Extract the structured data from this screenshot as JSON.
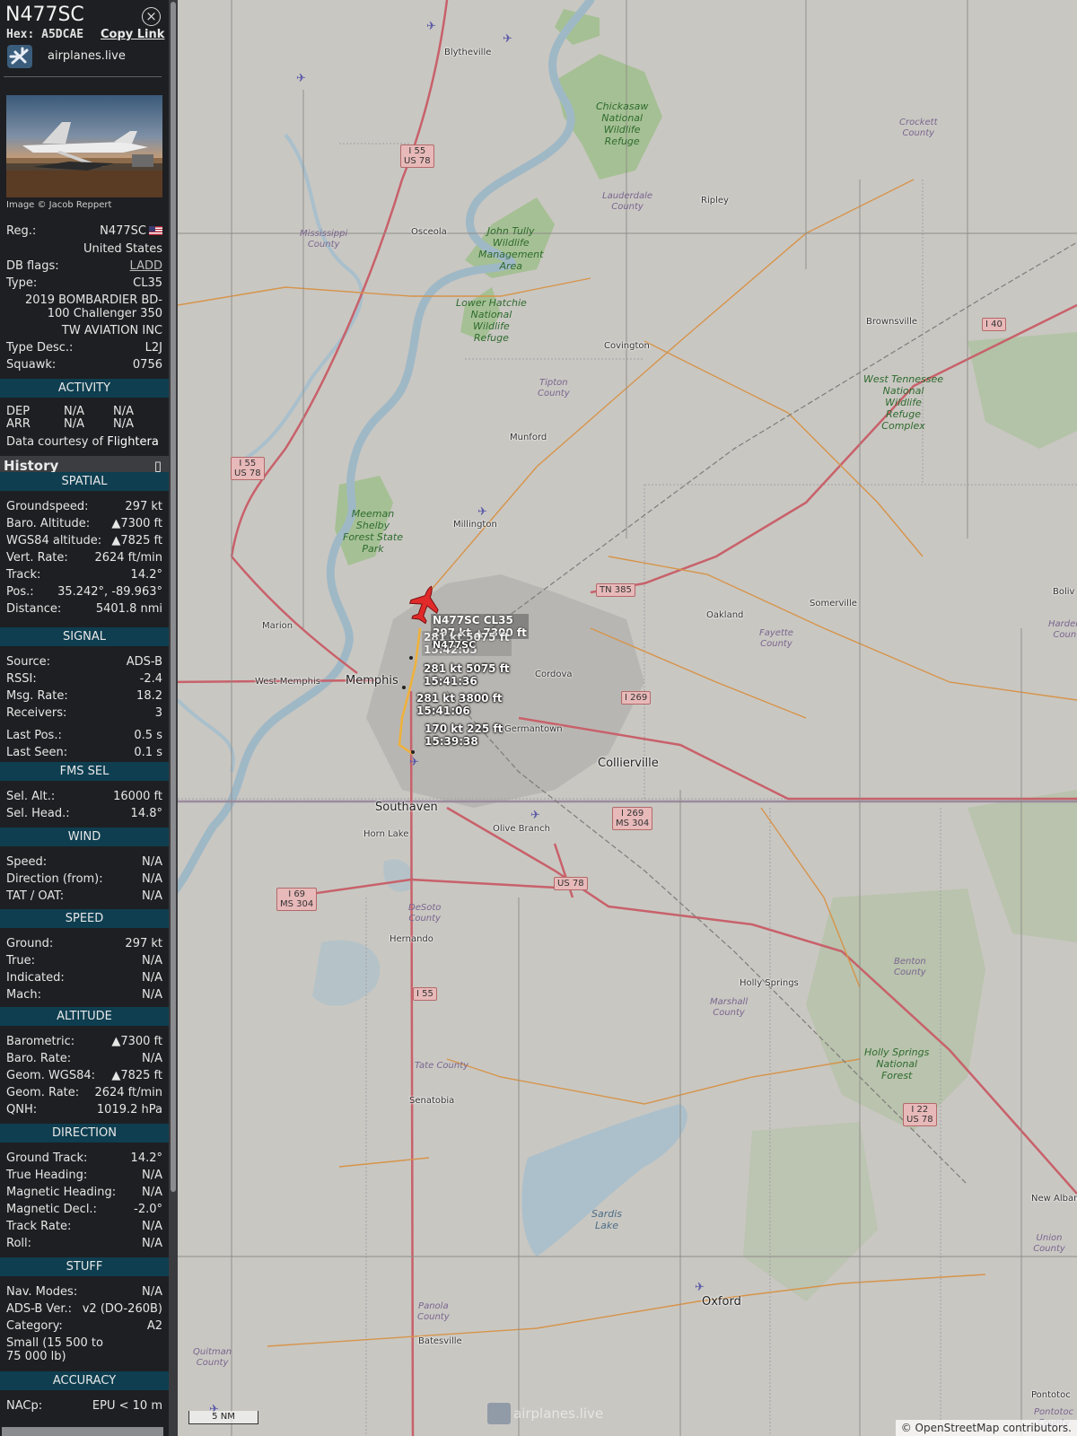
{
  "aircraft": {
    "callsign": "N477SC",
    "hex_label": "Hex:",
    "hex": "A5DCAE",
    "copy_link": "Copy Link",
    "provider": "airplanes.live",
    "photo_credit": "Image © Jacob Reppert",
    "reg_label": "Reg.:",
    "reg": "N477SC",
    "country": "United States",
    "db_flags_label": "DB flags:",
    "db_flags": "LADD",
    "type_label": "Type:",
    "type": "CL35",
    "type_full": "2019 BOMBARDIER BD-100 Challenger 350",
    "owner": "TW AVIATION INC",
    "type_desc_label": "Type Desc.:",
    "type_desc": "L2J",
    "squawk_label": "Squawk:",
    "squawk": "0756"
  },
  "activity": {
    "header": "ACTIVITY",
    "dep_label": "DEP",
    "dep_a": "N/A",
    "dep_b": "N/A",
    "arr_label": "ARR",
    "arr_a": "N/A",
    "arr_b": "N/A",
    "courtesy": "Data courtesy of",
    "courtesy_source": "Flightera"
  },
  "history": {
    "label": "History",
    "icon": "chevron-icon"
  },
  "spatial": {
    "header": "SPATIAL",
    "rows": [
      {
        "label": "Groundspeed:",
        "value": "297 kt"
      },
      {
        "label": "Baro. Altitude:",
        "value": "▲7300 ft"
      },
      {
        "label": "WGS84 altitude:",
        "value": "▲7825 ft"
      },
      {
        "label": "Vert. Rate:",
        "value": "2624 ft/min"
      },
      {
        "label": "Track:",
        "value": "14.2°"
      },
      {
        "label": "Pos.:",
        "value": "35.242°, -89.963°"
      },
      {
        "label": "Distance:",
        "value": "5401.8 nmi"
      }
    ]
  },
  "signal": {
    "header": "SIGNAL",
    "rows": [
      {
        "label": "Source:",
        "value": "ADS-B"
      },
      {
        "label": "RSSI:",
        "value": "-2.4"
      },
      {
        "label": "Msg. Rate:",
        "value": "18.2"
      },
      {
        "label": "Receivers:",
        "value": "3"
      },
      {
        "label": "Last Pos.:",
        "value": "0.5 s"
      },
      {
        "label": "Last Seen:",
        "value": "0.1 s"
      }
    ]
  },
  "fms": {
    "header": "FMS SEL",
    "rows": [
      {
        "label": "Sel. Alt.:",
        "value": "16000 ft"
      },
      {
        "label": "Sel. Head.:",
        "value": "14.8°"
      }
    ]
  },
  "wind": {
    "header": "WIND",
    "rows": [
      {
        "label": "Speed:",
        "value": "N/A"
      },
      {
        "label": "Direction (from):",
        "value": "N/A"
      },
      {
        "label": "TAT / OAT:",
        "value": "N/A"
      }
    ]
  },
  "speed": {
    "header": "SPEED",
    "rows": [
      {
        "label": "Ground:",
        "value": "297 kt"
      },
      {
        "label": "True:",
        "value": "N/A"
      },
      {
        "label": "Indicated:",
        "value": "N/A"
      },
      {
        "label": "Mach:",
        "value": "N/A"
      }
    ]
  },
  "altitude": {
    "header": "ALTITUDE",
    "rows": [
      {
        "label": "Barometric:",
        "value": "▲7300 ft"
      },
      {
        "label": "Baro. Rate:",
        "value": "N/A"
      },
      {
        "label": "Geom. WGS84:",
        "value": "▲7825 ft"
      },
      {
        "label": "Geom. Rate:",
        "value": "2624 ft/min"
      },
      {
        "label": "QNH:",
        "value": "1019.2 hPa"
      }
    ]
  },
  "direction": {
    "header": "DIRECTION",
    "rows": [
      {
        "label": "Ground Track:",
        "value": "14.2°"
      },
      {
        "label": "True Heading:",
        "value": "N/A"
      },
      {
        "label": "Magnetic Heading:",
        "value": "N/A"
      },
      {
        "label": "Magnetic Decl.:",
        "value": "-2.0°"
      },
      {
        "label": "Track Rate:",
        "value": "N/A"
      },
      {
        "label": "Roll:",
        "value": "N/A"
      }
    ]
  },
  "stuff": {
    "header": "STUFF",
    "rows": [
      {
        "label": "Nav. Modes:",
        "value": "N/A"
      },
      {
        "label": "ADS-B Ver.:",
        "value": "v2 (DO-260B)"
      },
      {
        "label": "Category:",
        "value": "A2"
      }
    ],
    "category_desc": "Small (15 500 to 75 000 lb)"
  },
  "accuracy": {
    "header": "ACCURACY",
    "rows": [
      {
        "label": "NACp:",
        "value": "EPU < 10 m"
      }
    ]
  },
  "map": {
    "aircraft_label": "N477SC CL35\n297 kt ▲7300 ft",
    "aircraft_label_ghost": "281 kt  5075 ft\n15:42:05",
    "aircraft_label_reg": "N477SC",
    "track_points": [
      {
        "label": "281 kt  5075 ft\n15:41:36"
      },
      {
        "label": "281 kt  3800 ft\n15:41:06"
      },
      {
        "label": "170 kt  225 ft\n15:39:38"
      }
    ],
    "cities": [
      "Memphis",
      "Collierville",
      "Southaven",
      "Oxford"
    ],
    "towns": [
      "Blytheville",
      "Osceola",
      "Ripley",
      "Brownsville",
      "Covington",
      "Munford",
      "Millington",
      "Marion",
      "West Memphis",
      "Oakland",
      "Cordova",
      "Germantown",
      "Somerville",
      "Olive Branch",
      "Horn Lake",
      "Hernando",
      "Holly Springs",
      "Senatobia",
      "Batesville",
      "New Albany",
      "Pontotoc",
      "Boliv"
    ],
    "counties": [
      "Mississippi\nCounty",
      "Lauderdale\nCounty",
      "Crockett\nCounty",
      "Tipton\nCounty",
      "Fayette\nCounty",
      "DeSoto\nCounty",
      "Marshall\nCounty",
      "Benton\nCounty",
      "Tate County",
      "Panola\nCounty",
      "Quitman\nCounty",
      "Union County",
      "Pontotoc\nCounty",
      "Harden\nCoun"
    ],
    "parks": [
      "Chickasaw\nNational\nWildlife\nRefuge",
      "John Tully\nWildlife\nManagement\nArea",
      "Lower Hatchie\nNational\nWildlife\nRefuge",
      "Meeman\nShelby\nForest State\nPark",
      "West Tennessee\nNational\nWildlife\nRefuge\nComplex",
      "Holly Springs\nNational\nForest",
      "Sardis\nLake"
    ],
    "shields": [
      "I 55\nUS 78",
      "I 55\nUS 78",
      "TN 385",
      "I 269",
      "I 269\nMS 304",
      "I 69\nMS 304",
      "US 78",
      "I 55",
      "I 40",
      "I 22\nUS 78"
    ],
    "scale": "5 NM",
    "attribution": "© OpenStreetMap contributors.",
    "watermark": "airplanes.live"
  }
}
